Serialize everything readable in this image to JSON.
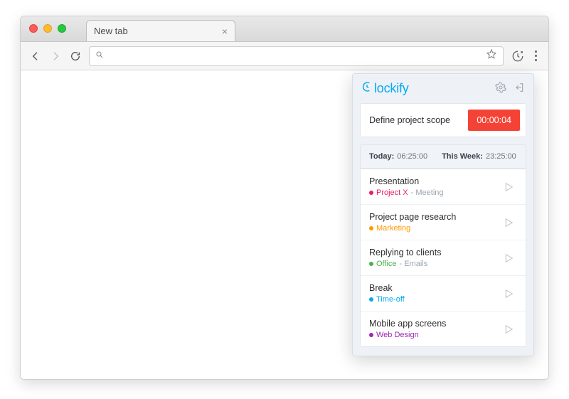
{
  "browser": {
    "tab_title": "New tab",
    "tab_close": "×"
  },
  "popup": {
    "brand": "lockify",
    "timer": {
      "description": "Define project scope",
      "elapsed": "00:00:04"
    },
    "summary": {
      "today_label": "Today:",
      "today_value": "06:25:00",
      "week_label": "This Week:",
      "week_value": "23:25:00"
    },
    "entries": [
      {
        "title": "Presentation",
        "project": "Project X",
        "task": "Meeting",
        "color": "#e91e63"
      },
      {
        "title": "Project page research",
        "project": "Marketing",
        "task": "",
        "color": "#ff9800"
      },
      {
        "title": "Replying to clients",
        "project": "Office",
        "task": "Emails",
        "color": "#4caf50"
      },
      {
        "title": "Break",
        "project": "Time-off",
        "task": "",
        "color": "#03a9f4"
      },
      {
        "title": "Mobile app screens",
        "project": "Web Design",
        "task": "",
        "color": "#9c27b0"
      }
    ]
  }
}
